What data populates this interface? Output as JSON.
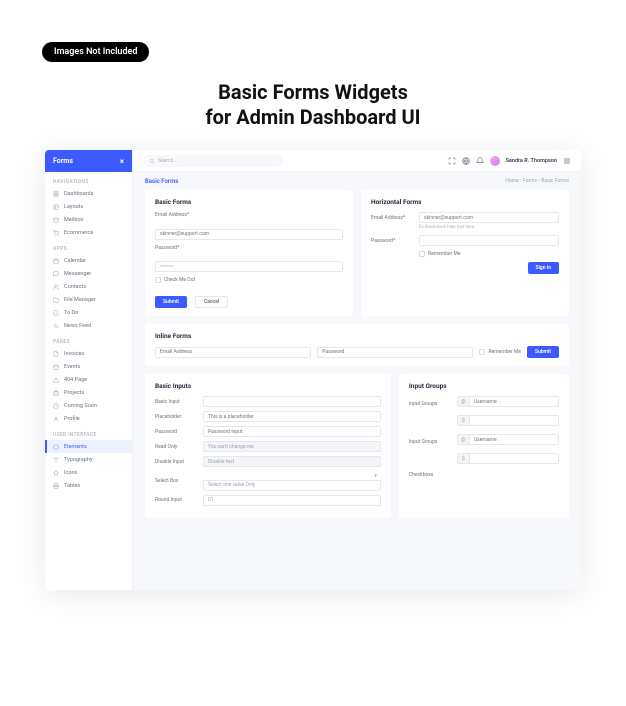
{
  "badge": "Images Not Included",
  "hero_l1": "Basic Forms Widgets",
  "hero_l2": "for Admin Dashboard UI",
  "sidebar": {
    "title": "Forms",
    "sections": [
      {
        "label": "NAVIGATIONS",
        "items": [
          {
            "icon": "grid",
            "label": "Dashboards"
          },
          {
            "icon": "layout",
            "label": "Layouts"
          },
          {
            "icon": "mail",
            "label": "Mailbox"
          },
          {
            "icon": "cart",
            "label": "Ecommerce"
          }
        ]
      },
      {
        "label": "APPS",
        "items": [
          {
            "icon": "calendar",
            "label": "Calendar"
          },
          {
            "icon": "chat",
            "label": "Messenger"
          },
          {
            "icon": "users",
            "label": "Contacts"
          },
          {
            "icon": "folder",
            "label": "File Manager"
          },
          {
            "icon": "check",
            "label": "To Do"
          },
          {
            "icon": "rss",
            "label": "News Feed"
          }
        ]
      },
      {
        "label": "PAGES",
        "items": [
          {
            "icon": "file",
            "label": "Invoices"
          },
          {
            "icon": "cal2",
            "label": "Events"
          },
          {
            "icon": "warn",
            "label": "404 Page"
          },
          {
            "icon": "brief",
            "label": "Projects"
          },
          {
            "icon": "clock",
            "label": "Coming Soon"
          },
          {
            "icon": "user",
            "label": "Profile"
          }
        ]
      },
      {
        "label": "USER INTERFACE",
        "items": [
          {
            "icon": "box",
            "label": "Elements",
            "active": true
          },
          {
            "icon": "type",
            "label": "Typography"
          },
          {
            "icon": "star",
            "label": "Icons"
          },
          {
            "icon": "table",
            "label": "Tables"
          }
        ]
      }
    ]
  },
  "header": {
    "search_ph": "Search...",
    "username": "Sandra R. Thompson"
  },
  "crumb": {
    "title": "Basic Forms",
    "path": "Home • Forms • Basic Forms"
  },
  "cards": {
    "basic": {
      "title": "Basic Forms",
      "email_lbl": "Email Address*",
      "email_ph": "skinner@support.com",
      "pwd_lbl": "Password*",
      "chk": "Check Me Out",
      "submit": "Submit",
      "cancel": "Cancel"
    },
    "horizontal": {
      "title": "Horizontal Forms",
      "email_lbl": "Email Address*",
      "email_ph": "skinner@support.com",
      "hint": "Ex block-level help text here",
      "pwd_lbl": "Password*",
      "remember": "Remember Me",
      "signin": "Sign In"
    },
    "inline": {
      "title": "Inline Forms",
      "email_ph": "Email Address",
      "pwd_ph": "Password",
      "remember": "Remember Me",
      "submit": "Submit"
    },
    "inputs": {
      "title": "Basic Inputs",
      "rows": [
        {
          "l": "Basic Input",
          "v": "",
          "t": "text"
        },
        {
          "l": "Placeholder",
          "v": "This is a placeholder",
          "t": "ph"
        },
        {
          "l": "Password",
          "v": "Password input",
          "t": "ph"
        },
        {
          "l": "Read Only",
          "v": "You can't change me",
          "t": "ro"
        },
        {
          "l": "Disable Input",
          "v": "Disable text",
          "t": "ro"
        },
        {
          "l": "Select Box",
          "v": "Select one value Only",
          "t": "sel"
        },
        {
          "l": "Round Input",
          "v": "01",
          "t": "text"
        }
      ]
    },
    "groups": {
      "title": "Input Groups",
      "lbl": "Input Groups",
      "ph": "Username",
      "at": "@",
      "dollar": "$",
      "check_t": "Checkboxs"
    }
  }
}
